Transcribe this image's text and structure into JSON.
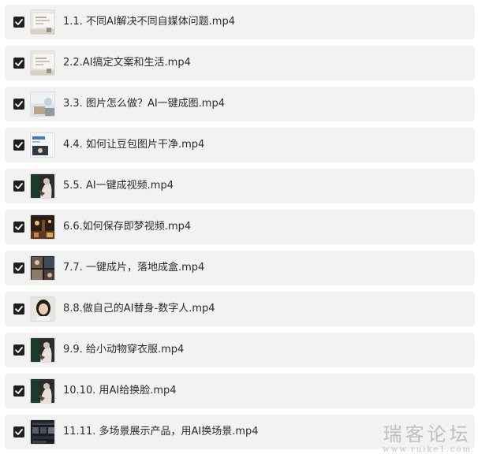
{
  "files": [
    {
      "name": "1.1. 不同AI解决不同自媒体问题.mp4",
      "checked": true,
      "thumb": "whiteboard"
    },
    {
      "name": "2.2.AI搞定文案和生活.mp4",
      "checked": true,
      "thumb": "whiteboard"
    },
    {
      "name": "3.3. 图片怎么做？AI一键成图.mp4",
      "checked": true,
      "thumb": "light-photo"
    },
    {
      "name": "4.4. 如何让豆包图片干净.mp4",
      "checked": true,
      "thumb": "phone-screen"
    },
    {
      "name": "5.5. AI一键成视频.mp4",
      "checked": true,
      "thumb": "dark-figure"
    },
    {
      "name": "6.6.如何保存即梦视频.mp4",
      "checked": true,
      "thumb": "night-street"
    },
    {
      "name": "7.7. 一键成片，落地成盒.mp4",
      "checked": true,
      "thumb": "collage"
    },
    {
      "name": "8.8.做自己的AI替身-数字人.mp4",
      "checked": true,
      "thumb": "portrait"
    },
    {
      "name": "9.9. 给小动物穿衣服.mp4",
      "checked": true,
      "thumb": "dark-figure"
    },
    {
      "name": "10.10. 用AI给换脸.mp4",
      "checked": true,
      "thumb": "dark-figure"
    },
    {
      "name": "11.11. 多场景展示产品，用AI换场景.mp4",
      "checked": true,
      "thumb": "app-ui"
    }
  ],
  "watermark": {
    "main": "瑞客论坛",
    "sub": "www.ruike1.com"
  },
  "colors": {
    "row_bg": "#f2f2f2",
    "checkbox": "#1f1f1f",
    "text": "#2b2b2b"
  }
}
